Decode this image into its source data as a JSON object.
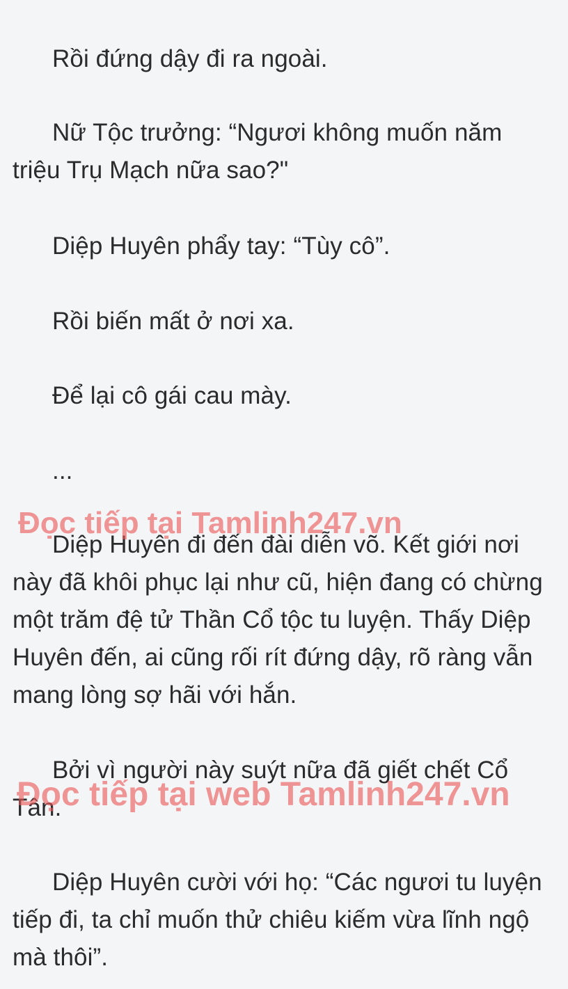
{
  "paragraphs": [
    "Rồi đứng dậy đi ra ngoài.",
    "Nữ Tộc trưởng: “Ngươi không muốn năm triệu Trụ Mạch nữa sao?\"",
    "Diệp Huyên phẩy tay: “Tùy cô”.",
    "Rồi biến mất ở nơi xa.",
    "Để lại cô gái cau mày.",
    "...",
    "Diệp Huyên đi đến đài diễn võ. Kết giới nơi này đã khôi phục lại như cũ, hiện đang có chừng một trăm đệ tử Thần Cổ tộc tu luyện. Thấy Diệp Huyên đến, ai cũng rối rít đứng dậy, rõ ràng vẫn mang lòng sợ hãi với hắn.",
    "Bởi vì người này suýt nữa đã giết chết Cổ Tân.",
    "Diệp Huyên cười với họ: “Các ngươi tu luyện tiếp đi, ta chỉ muốn thử chiêu kiếm vừa lĩnh ngộ mà thôi”."
  ],
  "watermarks": [
    "Đọc tiếp tại Tamlinh247.vn",
    "Đọc tiếp tại web Tamlinh247.vn"
  ],
  "colors": {
    "background": "#f4f5f7",
    "text": "#2b2b2b",
    "watermark": "#ec5858"
  }
}
